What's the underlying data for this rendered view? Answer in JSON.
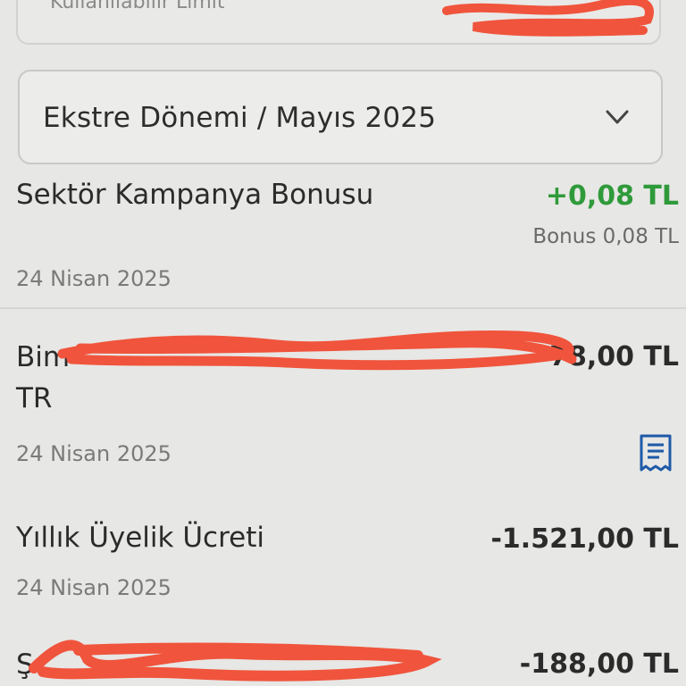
{
  "available_limit": {
    "label": "Kullanılabilir Limit"
  },
  "statement_dropdown": {
    "label": "Ekstre Dönemi / Mayıs 2025"
  },
  "transactions": [
    {
      "title": "Sektör Kampanya Bonusu",
      "amount": "+0,08 TL",
      "sub": "Bonus 0,08 TL",
      "date": "24 Nisan 2025"
    },
    {
      "title": "Bim",
      "title_line2": "TR",
      "amount": "78,00 TL",
      "date": "24 Nisan 2025"
    },
    {
      "title": "Yıllık Üyelik Ücreti",
      "amount": "-1.521,00 TL",
      "date": "24 Nisan 2025"
    },
    {
      "title": "Ş",
      "amount": "-188,00 TL"
    }
  ],
  "colors": {
    "positive": "#2f9a3a",
    "icon_blue": "#1e5aa8",
    "redaction": "#f0543c"
  },
  "icons": {
    "dropdown": "chevron-down-icon",
    "receipt": "receipt-icon"
  }
}
